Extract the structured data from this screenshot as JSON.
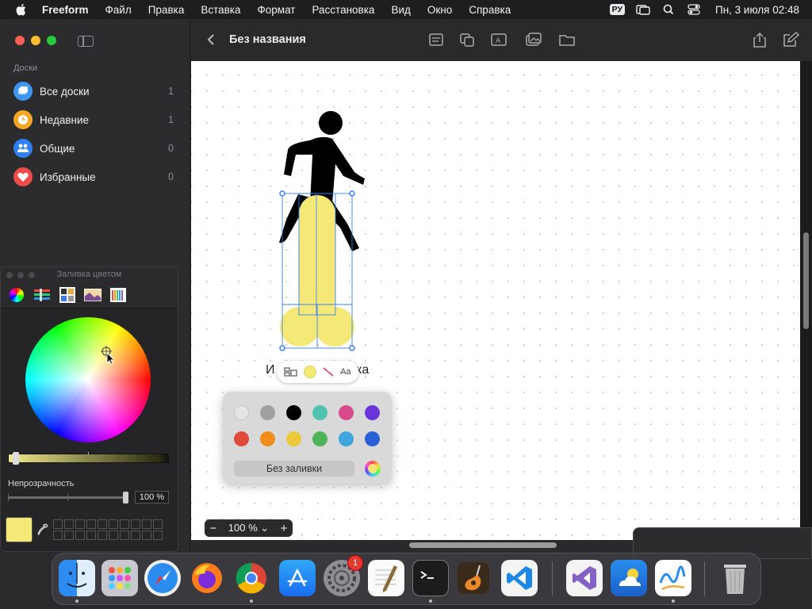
{
  "menubar": {
    "app": "Freeform",
    "items": [
      "Файл",
      "Правка",
      "Вставка",
      "Формат",
      "Расстановка",
      "Вид",
      "Окно",
      "Справка"
    ],
    "input_source": "РУ",
    "clock": "Пн, 3 июля  02:48"
  },
  "sidebar": {
    "section_label": "Доски",
    "items": [
      {
        "label": "Все доски",
        "count": "1",
        "icon": "boards-icon",
        "color": "#3e95f2"
      },
      {
        "label": "Недавние",
        "count": "1",
        "icon": "clock-icon",
        "color": "#f5a623"
      },
      {
        "label": "Общие",
        "count": "0",
        "icon": "people-icon",
        "color": "#2f7ff0"
      },
      {
        "label": "Избранные",
        "count": "0",
        "icon": "heart-icon",
        "color": "#ef4b4b"
      }
    ]
  },
  "color_panel": {
    "title": "Заливка цветом",
    "modes": [
      "color-wheel-icon",
      "sliders-icon",
      "palettes-icon",
      "image-palette-icon",
      "pencils-icon"
    ],
    "opacity_label": "Непрозрачность",
    "opacity_value": "100 %",
    "opacity_fraction": 1.0,
    "current_color": "#f4e876"
  },
  "toolbar": {
    "title": "Без названия",
    "icons": [
      "note-icon",
      "shapes-icon",
      "text-box-icon",
      "media-icon",
      "file-icon",
      "share-icon",
      "edit-icon"
    ]
  },
  "canvas": {
    "label_left": "И",
    "label_right": "ка",
    "selected_fill": "#f4e876"
  },
  "floating_bar": {
    "text_button": "Aa",
    "icons": [
      "arrange-icon",
      "fill-color-icon",
      "no-line-icon",
      "text-style-icon"
    ]
  },
  "fill_popover": {
    "swatches_row1": [
      "#e4e4e4",
      "#a0a0a0",
      "#000000",
      "#4fc2b0",
      "#d84b8b",
      "#6a35d8"
    ],
    "swatches_row2": [
      "#e04a3a",
      "#ef8c1a",
      "#ecc93b",
      "#4fb35a",
      "#3da6dc",
      "#2a60d6"
    ],
    "no_fill_label": "Без заливки"
  },
  "zoom": {
    "minus": "−",
    "value": "100 %",
    "chevron": "⌄",
    "plus": "+"
  },
  "dock": {
    "apps": [
      "Finder",
      "Launchpad",
      "Safari",
      "Firefox",
      "Chrome",
      "App Store",
      "System Settings",
      "TextEdit",
      "Terminal",
      "GarageBand",
      "Visual Studio Code",
      "Visual Studio",
      "Weather",
      "Freeform",
      "Trash"
    ],
    "settings_badge": "1"
  }
}
